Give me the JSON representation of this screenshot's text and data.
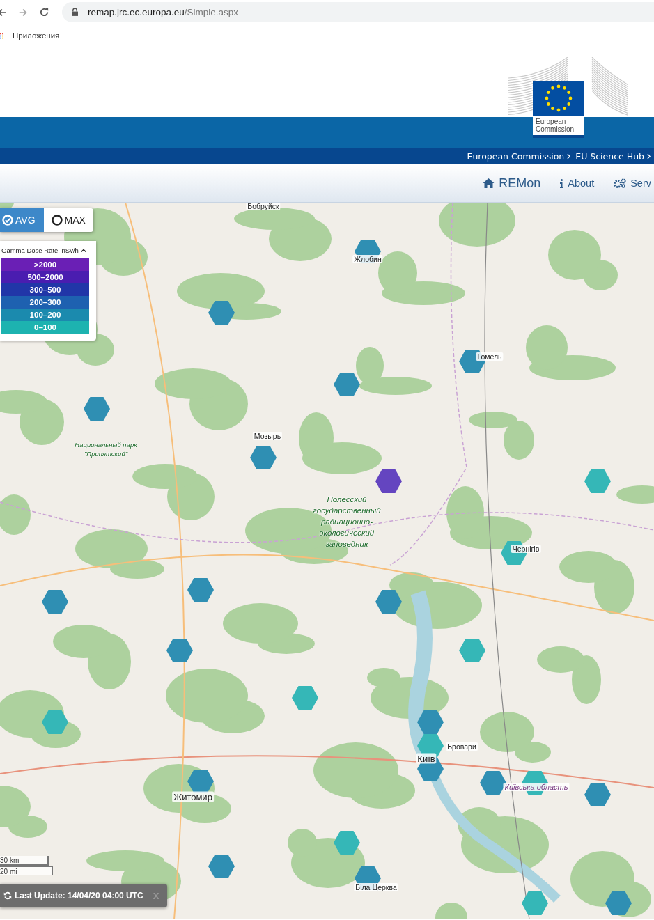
{
  "browser": {
    "url_host": "remap.jrc.ec.europa.eu",
    "url_path": "/Simple.aspx",
    "bookmarks": [
      "Приложения"
    ]
  },
  "header": {
    "logo_lines": [
      "European",
      "Commission"
    ],
    "breadcrumb": [
      "European Commission",
      "EU Science Hub"
    ]
  },
  "nav": [
    {
      "label": "REMon",
      "kind": "home"
    },
    {
      "label": "About",
      "kind": "info"
    },
    {
      "label": "Serv",
      "kind": "gears"
    }
  ],
  "toggle": [
    {
      "label": "AVG",
      "selected": true
    },
    {
      "label": "MAX",
      "selected": false
    }
  ],
  "legend": {
    "title": "Gamma Dose Rate, nSv/h",
    "expanded": true,
    "classes": [
      {
        "label": ">2000",
        "color": "#6a1fb5"
      },
      {
        "label": "500–2000",
        "color": "#4a1db0"
      },
      {
        "label": "300–500",
        "color": "#2136a8"
      },
      {
        "label": "200–300",
        "color": "#1e61b0"
      },
      {
        "label": "100–200",
        "color": "#1b8aae"
      },
      {
        "label": "0–100",
        "color": "#1db3b0"
      }
    ]
  },
  "map": {
    "places": [
      {
        "name": "Бобруйск",
        "kind": "city"
      },
      {
        "name": "Жлобин",
        "kind": "city"
      },
      {
        "name": "Гомель",
        "kind": "city"
      },
      {
        "name": "Мозырь",
        "kind": "city"
      },
      {
        "name": "Национальный парк \"Припятский\"",
        "kind": "park"
      },
      {
        "name": "Полесский государственный радиационно-экологический заповедник",
        "kind": "park"
      },
      {
        "name": "Чернігів",
        "kind": "city"
      },
      {
        "name": "Бровари",
        "kind": "city"
      },
      {
        "name": "Київ",
        "kind": "capital"
      },
      {
        "name": "Київська область",
        "kind": "region"
      },
      {
        "name": "Житомир",
        "kind": "capital"
      },
      {
        "name": "Біла Церква",
        "kind": "city"
      }
    ],
    "stations": [
      {
        "color": "#2f8fb3"
      },
      {
        "color": "#2f8fb3"
      },
      {
        "color": "#2f8fb3"
      },
      {
        "color": "#2f8fb3"
      },
      {
        "color": "#2f8fb3"
      },
      {
        "color": "#2f8fb3"
      },
      {
        "color": "#6445c0"
      },
      {
        "color": "#35b7b7"
      },
      {
        "color": "#35b7b7"
      },
      {
        "color": "#2f8fb3"
      },
      {
        "color": "#2f8fb3"
      },
      {
        "color": "#2f8fb3"
      },
      {
        "color": "#2f8fb3"
      },
      {
        "color": "#35b7b7"
      },
      {
        "color": "#35b7b7"
      },
      {
        "color": "#35b7b7"
      },
      {
        "color": "#2f8fb3"
      },
      {
        "color": "#35b7b7"
      },
      {
        "color": "#2f8fb3"
      },
      {
        "color": "#2f8fb3"
      },
      {
        "color": "#2f8fb3"
      },
      {
        "color": "#35b7b7"
      },
      {
        "color": "#2f8fb3"
      },
      {
        "color": "#35b7b7"
      },
      {
        "color": "#2f8fb3"
      },
      {
        "color": "#2f8fb3"
      },
      {
        "color": "#35b7b7"
      },
      {
        "color": "#2f8fb3"
      }
    ],
    "scale": [
      "30 km",
      "20 mi"
    ]
  },
  "status": {
    "text": "Last Update: 14/04/20 04:00 UTC",
    "close": "X"
  }
}
